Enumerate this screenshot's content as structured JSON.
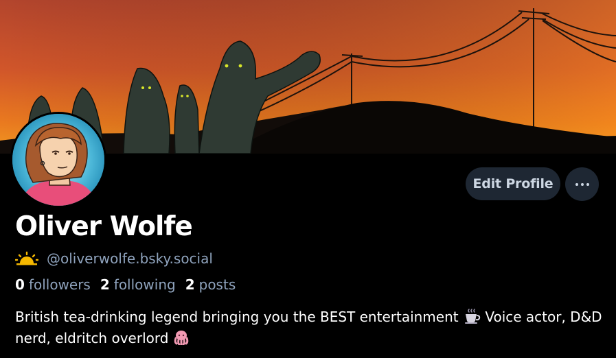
{
  "profile": {
    "display_name": "Oliver Wolfe",
    "handle": "@oliverwolfe.bsky.social",
    "stats": {
      "followers_count": "0",
      "followers_label": "followers",
      "following_count": "2",
      "following_label": "following",
      "posts_count": "2",
      "posts_label": "posts"
    },
    "bio_part1": "British tea-drinking legend bringing you the BEST entertainment",
    "bio_part2": "Voice actor, D&D nerd, eldritch overlord"
  },
  "actions": {
    "edit_profile_label": "Edit Profile"
  },
  "icons": {
    "handle_prefix": "sunrise-icon",
    "tea": "teacup-icon",
    "octopus": "octopus-icon",
    "more": "ellipsis-icon"
  },
  "colors": {
    "background": "#000000",
    "button_bg": "#1e2733",
    "button_text": "#cdd7e3",
    "muted_text": "#8fa3bd",
    "sun": "#f5b800"
  }
}
